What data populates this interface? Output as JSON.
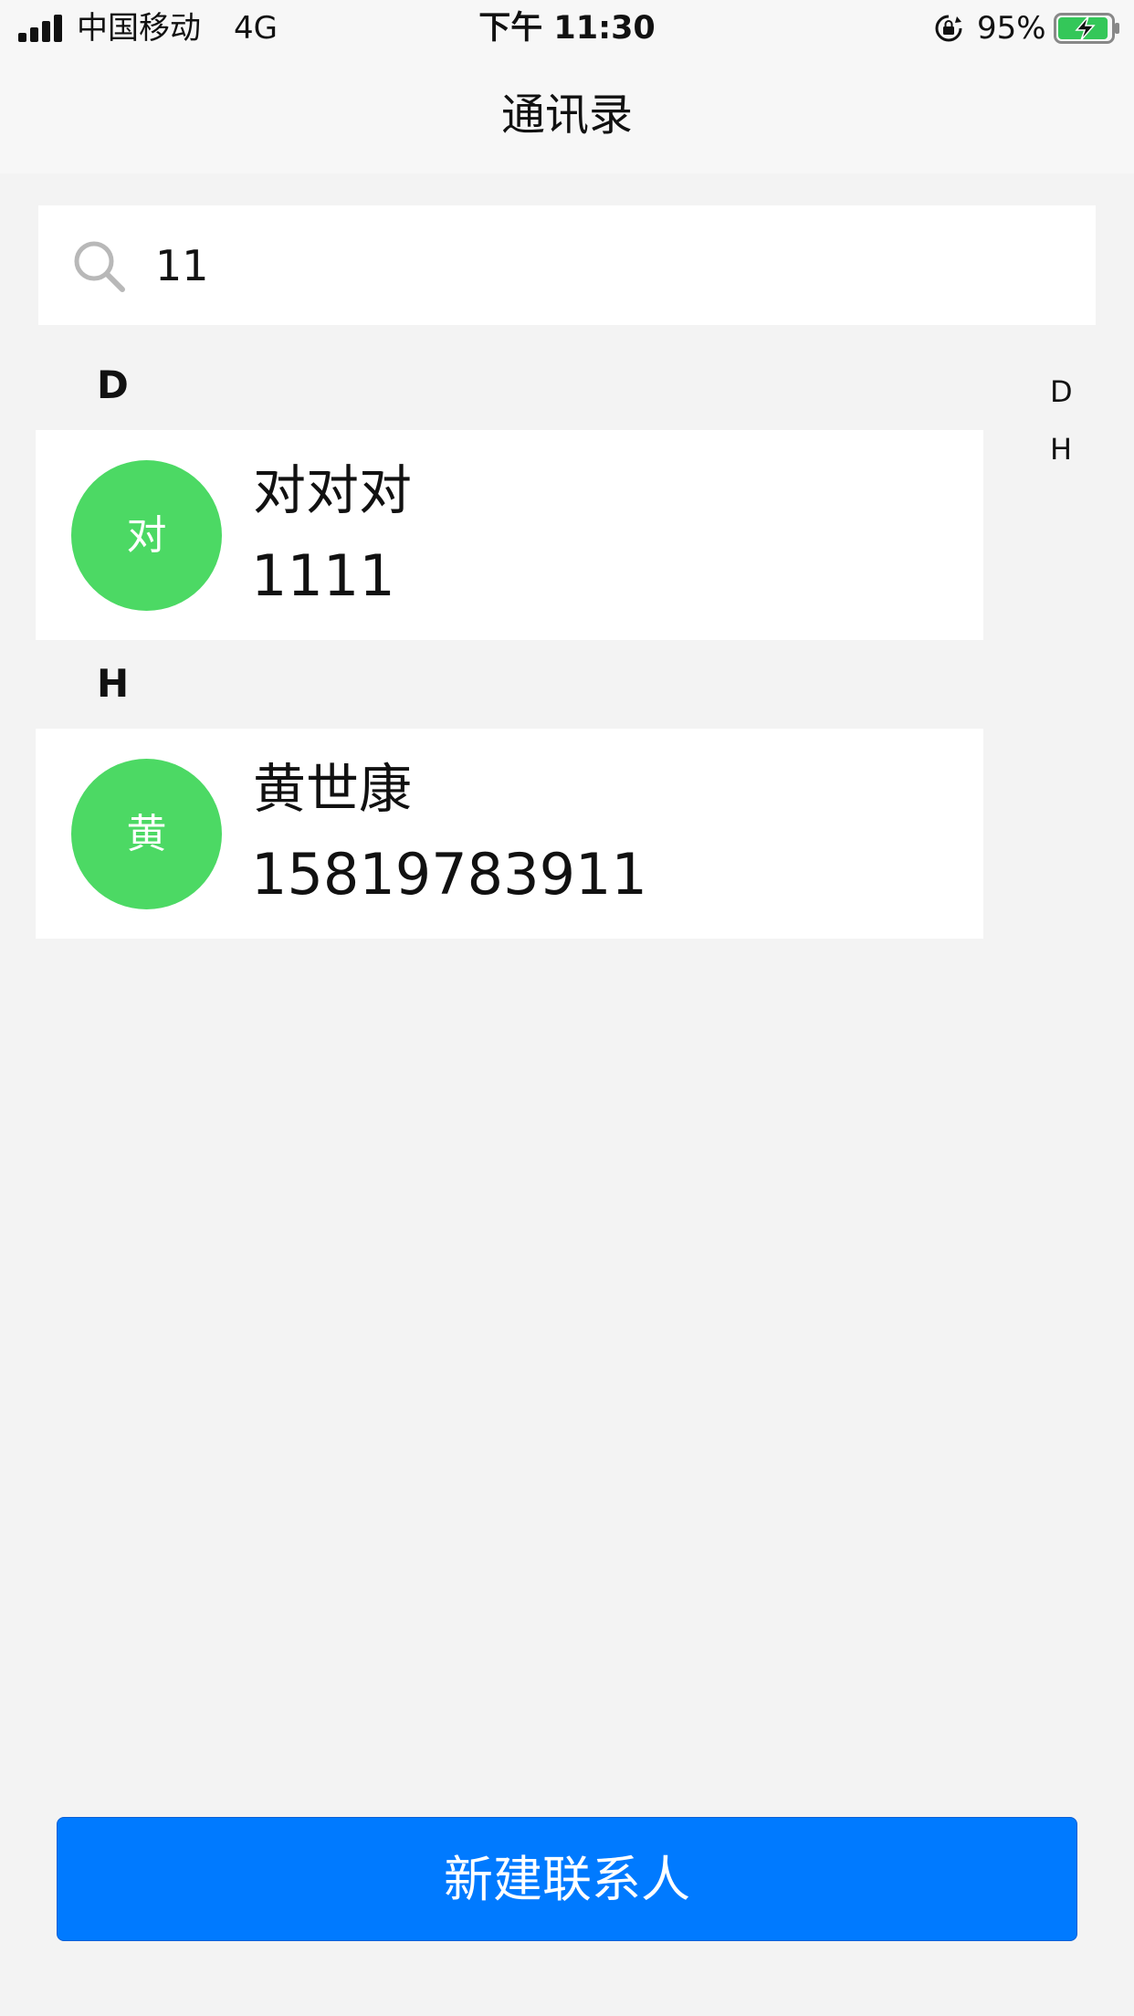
{
  "status_bar": {
    "carrier": "中国移动",
    "network": "4G",
    "time": "下午 11:30",
    "battery_percent": "95%",
    "battery_level": 0.95,
    "icons": [
      "signal-icon",
      "rotation-lock-icon",
      "battery-charging-icon"
    ]
  },
  "nav": {
    "title": "通讯录"
  },
  "search": {
    "value": "11",
    "icon": "search-icon"
  },
  "sections": [
    {
      "letter": "D",
      "contacts": [
        {
          "avatar_text": "对",
          "name": "对对对",
          "phone": "1111"
        }
      ]
    },
    {
      "letter": "H",
      "contacts": [
        {
          "avatar_text": "黄",
          "name": "黄世康",
          "phone": "15819783911"
        }
      ]
    }
  ],
  "index_bar": [
    "D",
    "H"
  ],
  "buttons": {
    "new_contact": "新建联系人"
  },
  "colors": {
    "avatar_green": "#4cd964",
    "primary_blue": "#007aff",
    "background": "#f3f3f3",
    "battery_green": "#34c759"
  }
}
